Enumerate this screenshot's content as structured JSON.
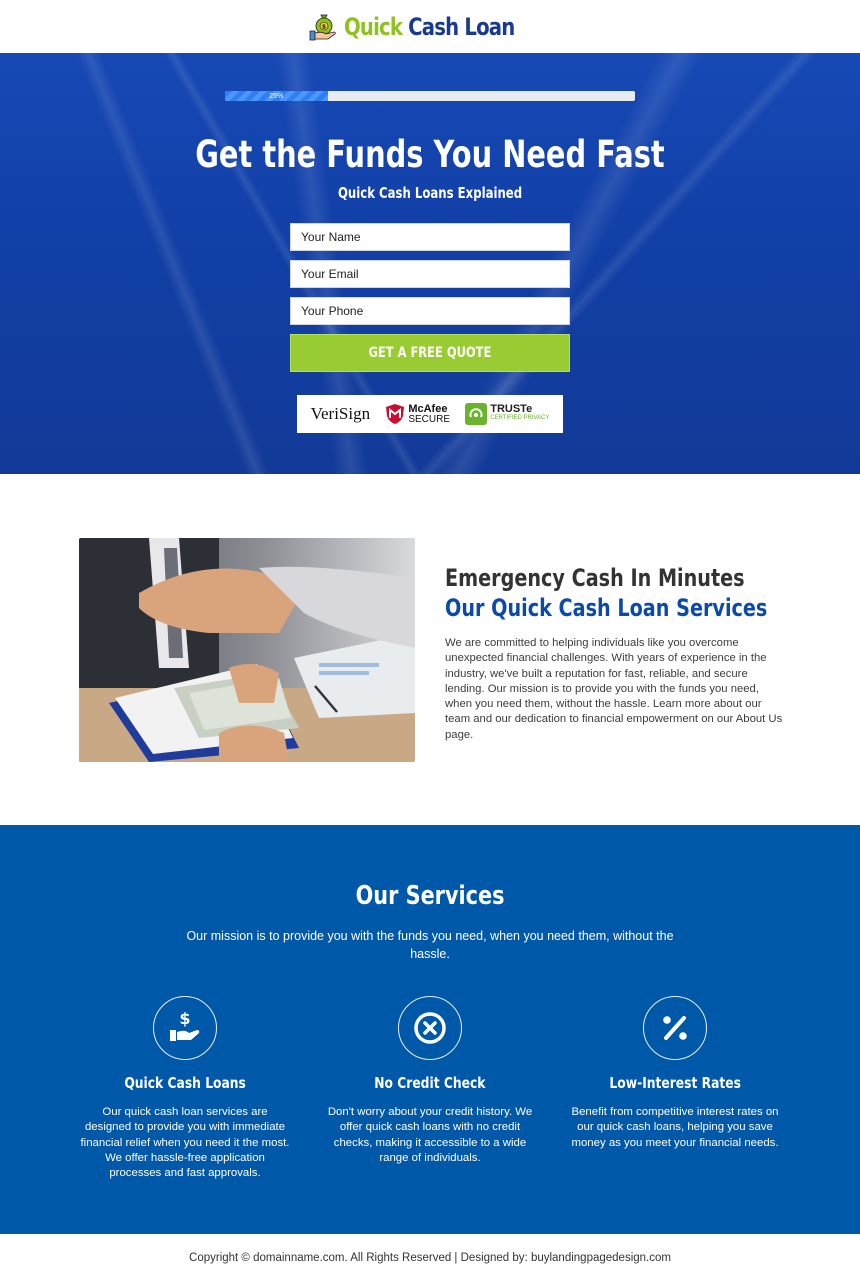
{
  "header": {
    "logo_icon": "money-bag-hand-icon",
    "logo_word1": "Quick",
    "logo_word2": "Cash Loan"
  },
  "hero": {
    "progress": {
      "percent": 25,
      "label": "25%"
    },
    "title": "Get the Funds You Need Fast",
    "subtitle": "Quick Cash Loans Explained",
    "form": {
      "name_placeholder": "Your Name",
      "email_placeholder": "Your Email",
      "phone_placeholder": "Your Phone",
      "name_value": "",
      "email_value": "",
      "phone_value": "",
      "submit_label": "GET A FREE QUOTE"
    },
    "trust_badges": [
      {
        "name": "VeriSign",
        "icon": "verisign-logo"
      },
      {
        "name": "McAfee",
        "sub": "SECURE",
        "icon": "mcafee-shield-icon"
      },
      {
        "name": "TRUSTe",
        "sub": "CERTIFIED PRIVACY",
        "icon": "truste-logo-icon"
      }
    ]
  },
  "about": {
    "image_alt": "Business handshake with cash being handed over a contract",
    "heading_line1": "Emergency Cash In Minutes",
    "heading_line2": "Our Quick Cash Loan Services",
    "paragraph": "We are committed to helping individuals like you overcome unexpected financial challenges. With years of experience in the industry, we've built a reputation for fast, reliable, and secure lending. Our mission is to provide you with the funds you need, when you need them, without the hassle. Learn more about our team and our dedication to financial empowerment on our About Us page."
  },
  "services": {
    "title": "Our Services",
    "subtitle": "Our mission is to provide you with the funds you need, when you need them, without the hassle.",
    "items": [
      {
        "icon": "dollar-hand-icon",
        "title": "Quick Cash Loans",
        "text": "Our quick cash loan services are designed to provide you with immediate financial relief when you need it the most. We offer hassle-free application processes and fast approvals."
      },
      {
        "icon": "x-circle-icon",
        "title": "No Credit Check",
        "text": "Don't worry about your credit history. We offer quick cash loans with no credit checks, making it accessible to a wide range of individuals."
      },
      {
        "icon": "percent-icon",
        "title": "Low-Interest Rates",
        "text": "Benefit from competitive interest rates on our quick cash loans, helping you save money as you meet your financial needs."
      }
    ]
  },
  "footer": {
    "text": "Copyright © domainname.com. All Rights Reserved | Designed by: buylandingpagedesign.com"
  },
  "colors": {
    "brand_green": "#8dc21f",
    "brand_navy": "#1a3a8f",
    "hero_blue": "#1445ad",
    "cta_green": "#99cc33",
    "accent_blue": "#0b4aa8",
    "services_bg": "#0058a9"
  }
}
